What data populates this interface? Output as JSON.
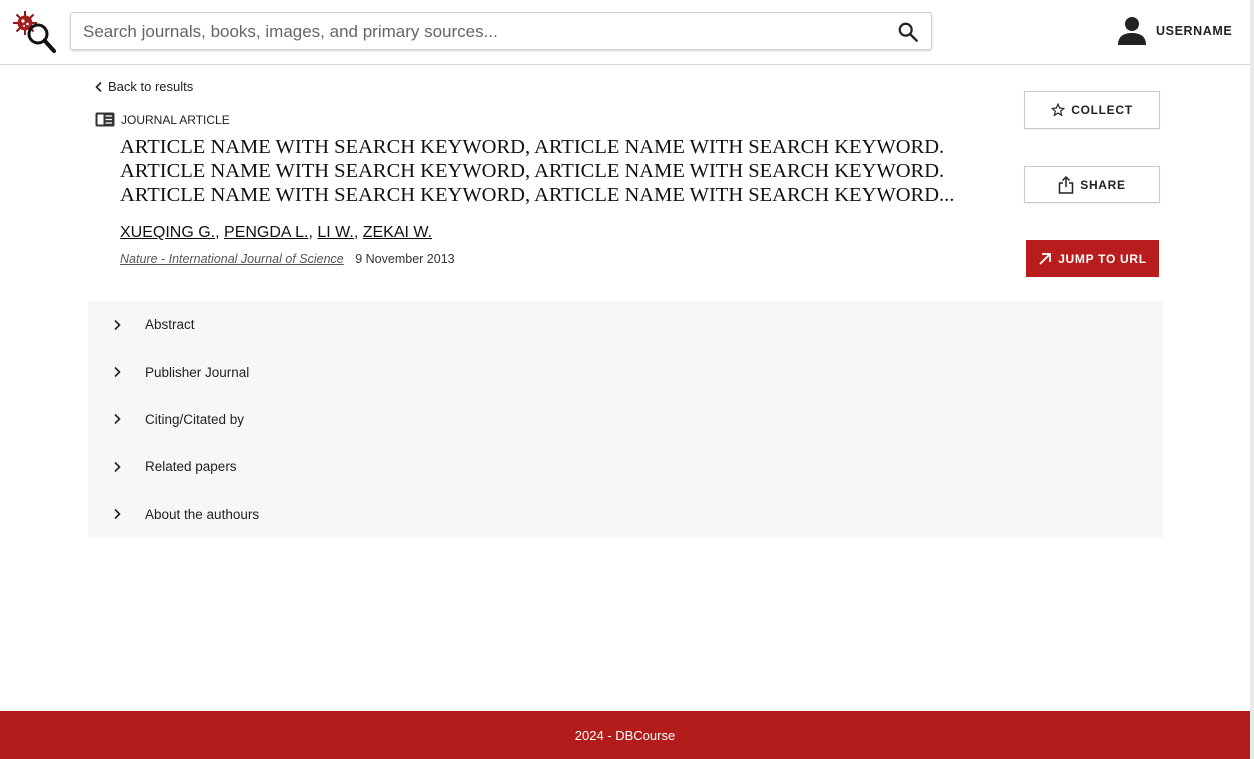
{
  "header": {
    "search_placeholder": "Search journals, books, images, and primary sources...",
    "username": "USERNAME"
  },
  "nav": {
    "back_label": "Back to results"
  },
  "article": {
    "type_label": "JOURNAL ARTICLE",
    "title_lines": [
      "ARTICLE NAME WITH SEARCH KEYWORD, ARTICLE NAME WITH SEARCH KEYWORD.",
      "ARTICLE NAME WITH SEARCH KEYWORD, ARTICLE NAME WITH SEARCH KEYWORD.",
      "ARTICLE NAME WITH SEARCH KEYWORD, ARTICLE NAME WITH SEARCH KEYWORD..."
    ],
    "authors": [
      "XUEQING G.",
      "PENGDA L.",
      "LI W.",
      "ZEKAI W."
    ],
    "journal": "Nature - International Journal of Science",
    "date": "9 November 2013"
  },
  "actions": {
    "collect_label": "COLLECT",
    "share_label": "SHARE",
    "jump_label": "JUMP TO URL"
  },
  "sections": [
    {
      "label": "Abstract"
    },
    {
      "label": "Publisher Journal"
    },
    {
      "label": "Citing/Citated by"
    },
    {
      "label": "Related papers"
    },
    {
      "label": "About the authours"
    }
  ],
  "footer": {
    "text": "2024 - DBCourse"
  },
  "colors": {
    "brand": "#b41c1c",
    "accordion_bg": "#f7f7f7"
  }
}
